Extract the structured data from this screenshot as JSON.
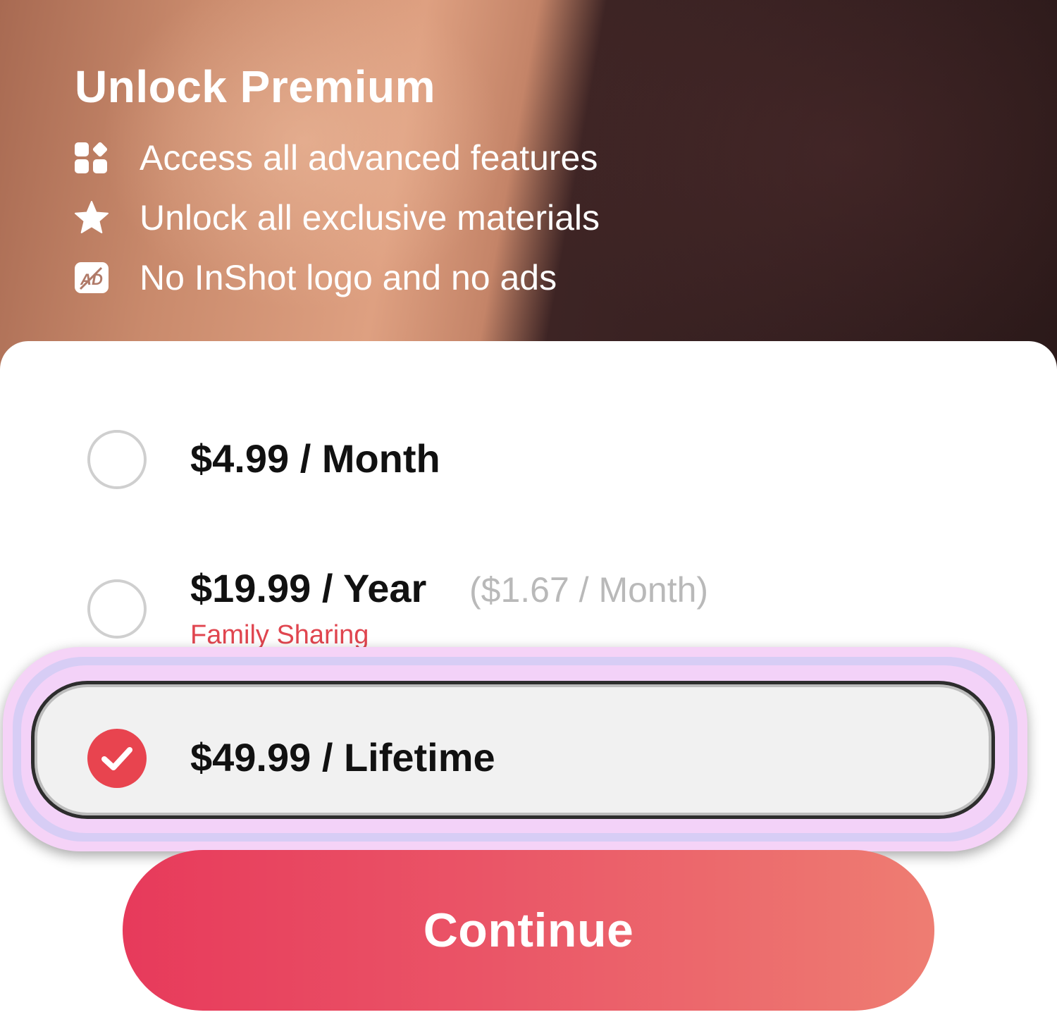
{
  "hero": {
    "title": "Unlock Premium",
    "features": [
      {
        "icon": "grid-icon",
        "text": "Access all advanced features"
      },
      {
        "icon": "star-icon",
        "text": "Unlock all exclusive materials"
      },
      {
        "icon": "no-ads-icon",
        "text": "No InShot logo and no ads"
      }
    ]
  },
  "plans": [
    {
      "price": "$4.99 / Month",
      "selected": false
    },
    {
      "price": "$19.99 / Year",
      "sub": "($1.67 / Month)",
      "badge": "Family Sharing",
      "selected": false
    },
    {
      "price": "$49.99 / Lifetime",
      "selected": true
    }
  ],
  "continue_label": "Continue",
  "colors": {
    "accent": "#e8444f",
    "badge": "#e0454f",
    "button_start": "#e73a5b",
    "button_end": "#ee7d72"
  }
}
